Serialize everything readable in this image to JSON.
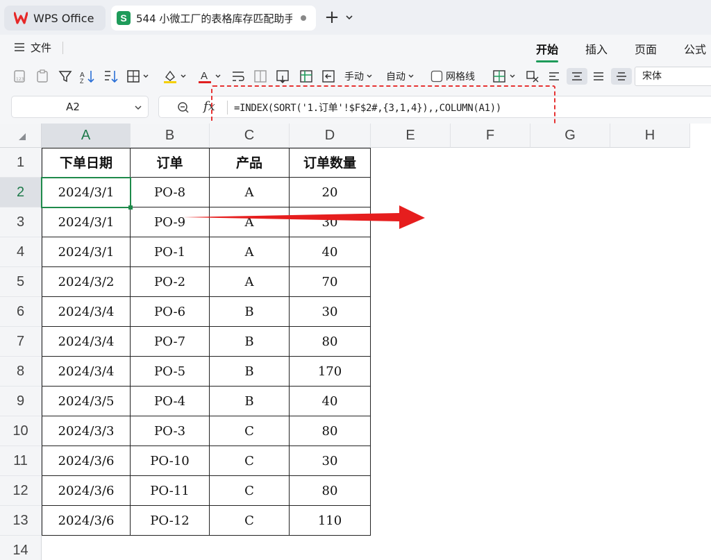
{
  "tabs": {
    "wps_label": "WPS Office",
    "doc_label": "544 小微工厂的表格库存匹配助手",
    "doc_icon_letter": "S"
  },
  "menu": {
    "file_label": "文件",
    "ribbon_tabs": [
      "开始",
      "插入",
      "页面",
      "公式"
    ],
    "active_tab": "开始"
  },
  "toolbar": {
    "manual_label": "手动",
    "auto_label": "自动",
    "gridlines_label": "网格线",
    "font_name": "宋体",
    "font_color": "#e02020",
    "fill_color": "#f5d000"
  },
  "formula_bar": {
    "name_box": "A2",
    "fx_label": "fx",
    "formula": "=INDEX(SORT('1.订单'!$F$2#,{3,1,4}),,COLUMN(A1))"
  },
  "sheet": {
    "columns": [
      "A",
      "B",
      "C",
      "D",
      "E",
      "F",
      "G",
      "H"
    ],
    "selected_column": "A",
    "selected_row": "2",
    "row_numbers": [
      "1",
      "2",
      "3",
      "4",
      "5",
      "6",
      "7",
      "8",
      "9",
      "10",
      "11",
      "12",
      "13",
      "14"
    ],
    "headers": [
      "下单日期",
      "订单",
      "产品",
      "订单数量"
    ],
    "rows": [
      [
        "2024/3/1",
        "PO-8",
        "A",
        "20"
      ],
      [
        "2024/3/1",
        "PO-9",
        "A",
        "30"
      ],
      [
        "2024/3/1",
        "PO-1",
        "A",
        "40"
      ],
      [
        "2024/3/2",
        "PO-2",
        "A",
        "70"
      ],
      [
        "2024/3/4",
        "PO-6",
        "B",
        "30"
      ],
      [
        "2024/3/4",
        "PO-7",
        "B",
        "80"
      ],
      [
        "2024/3/4",
        "PO-5",
        "B",
        "170"
      ],
      [
        "2024/3/5",
        "PO-4",
        "B",
        "40"
      ],
      [
        "2024/3/3",
        "PO-3",
        "C",
        "80"
      ],
      [
        "2024/3/6",
        "PO-10",
        "C",
        "30"
      ],
      [
        "2024/3/6",
        "PO-11",
        "C",
        "80"
      ],
      [
        "2024/3/6",
        "PO-12",
        "C",
        "110"
      ]
    ]
  },
  "annotation": {
    "highlight_color": "#e63232",
    "arrow_color": "#e61e1e"
  }
}
